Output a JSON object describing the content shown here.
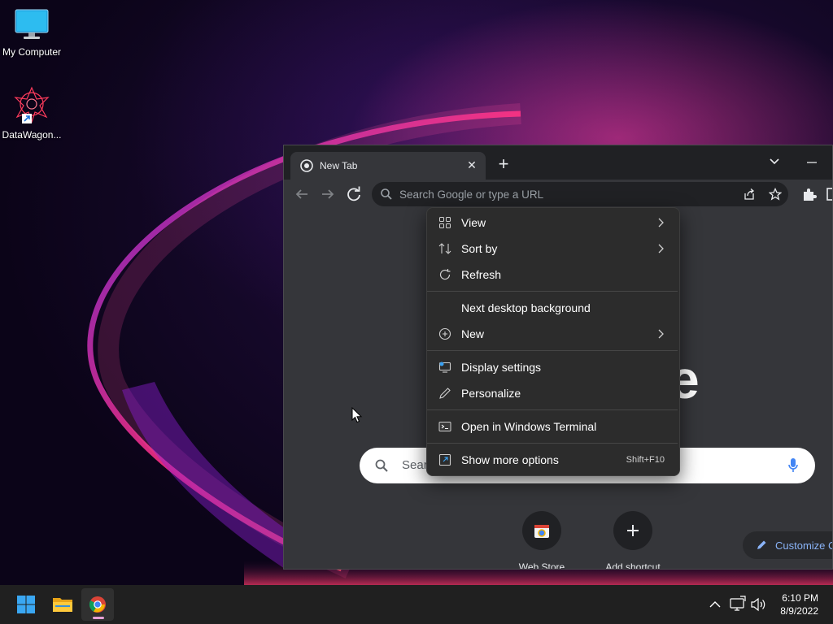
{
  "desktop": {
    "icons": [
      {
        "label": "My Computer",
        "icon": "monitor-icon"
      },
      {
        "label": "DataWagon...",
        "icon": "app-shortcut-icon"
      }
    ]
  },
  "browser": {
    "tab_title": "New Tab",
    "omnibox_placeholder": "Search Google or type a URL",
    "logo_partial": "e",
    "search_placeholder": "Sear",
    "shortcuts": [
      {
        "label": "Web Store",
        "icon": "web-store-icon"
      },
      {
        "label": "Add shortcut",
        "icon": "plus-icon"
      }
    ],
    "customize_label": "Customize C"
  },
  "context_menu": {
    "items": [
      {
        "label": "View",
        "icon": "view-grid-icon",
        "submenu": true
      },
      {
        "label": "Sort by",
        "icon": "sort-icon",
        "submenu": true
      },
      {
        "label": "Refresh",
        "icon": "refresh-icon",
        "submenu": false
      },
      {
        "label": "Next desktop background",
        "icon": "",
        "submenu": false
      },
      {
        "label": "New",
        "icon": "new-plus-circle-icon",
        "submenu": true
      },
      {
        "label": "Display settings",
        "icon": "display-settings-icon",
        "submenu": false
      },
      {
        "label": "Personalize",
        "icon": "pen-icon",
        "submenu": false
      },
      {
        "label": "Open in Windows Terminal",
        "icon": "terminal-icon",
        "submenu": false
      },
      {
        "label": "Show more options",
        "icon": "more-options-icon",
        "shortcut": "Shift+F10"
      }
    ]
  },
  "taskbar": {
    "apps": [
      "start-icon",
      "file-explorer-icon",
      "chrome-icon"
    ],
    "tray": [
      "chevron-up-icon",
      "network-icon",
      "volume-icon"
    ],
    "time": "6:10 PM",
    "date": "8/9/2022"
  },
  "colors": {
    "menu_bg": "#2c2c2c",
    "browser_bg": "#35363a",
    "taskbar_bg": "#202020",
    "accent_link": "#8ab4f8"
  }
}
